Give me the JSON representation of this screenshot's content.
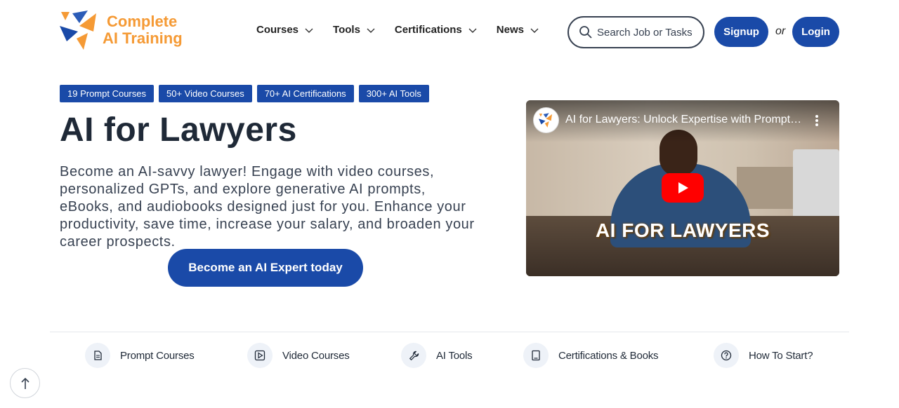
{
  "header": {
    "logo": {
      "line1": "Complete",
      "line2": "AI Training"
    },
    "nav": [
      {
        "label": "Courses"
      },
      {
        "label": "Tools"
      },
      {
        "label": "Certifications"
      },
      {
        "label": "News"
      }
    ],
    "search": {
      "placeholder": "Search Job or Tasks"
    },
    "signup_label": "Signup",
    "or_label": "or",
    "login_label": "Login"
  },
  "hero": {
    "badges": [
      "19 Prompt Courses",
      "50+ Video Courses",
      "70+ AI Certifications",
      "300+ AI Tools"
    ],
    "title": "AI for Lawyers",
    "description": "Become an AI-savvy lawyer! Engage with video courses, personalized GPTs, and explore generative AI prompts, eBooks, and audiobooks designed just for you. Enhance your productivity, save time, increase your salary, and broaden your career prospects.",
    "cta_label": "Become an AI Expert today"
  },
  "video": {
    "title": "AI for Lawyers: Unlock Expertise with Prompt Courses, AI Tools & Certifications",
    "caption": "AI FOR LAWYERS"
  },
  "bottom_nav": [
    {
      "label": "Prompt Courses",
      "icon": "document-icon"
    },
    {
      "label": "Video Courses",
      "icon": "play-square-icon"
    },
    {
      "label": "AI Tools",
      "icon": "wrench-icon"
    },
    {
      "label": "Certifications & Books",
      "icon": "book-icon"
    },
    {
      "label": "How To Start?",
      "icon": "question-circle-icon"
    }
  ],
  "colors": {
    "brand_blue": "#1a4aa8",
    "logo_orange": "#f59a35",
    "text_dark": "#1f2937"
  }
}
